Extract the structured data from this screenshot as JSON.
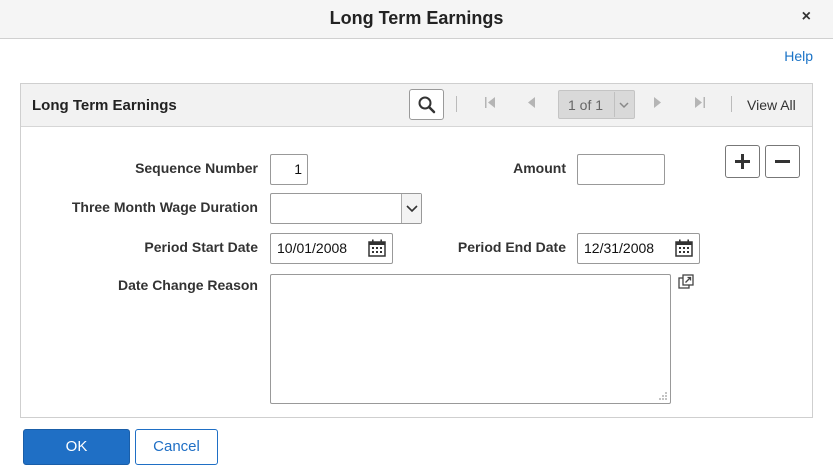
{
  "window": {
    "title": "Long Term Earnings",
    "close_glyph": "×",
    "help_link": "Help"
  },
  "panel": {
    "title": "Long Term Earnings",
    "pager_text": "1 of 1",
    "view_all": "View All"
  },
  "form": {
    "sequence_number_label": "Sequence Number",
    "sequence_number_value": "1",
    "amount_label": "Amount",
    "amount_value": "",
    "wage_duration_label": "Three Month Wage Duration",
    "wage_duration_value": "",
    "period_start_label": "Period Start Date",
    "period_start_value": "10/01/2008",
    "period_end_label": "Period End Date",
    "period_end_value": "12/31/2008",
    "date_change_reason_label": "Date Change Reason",
    "date_change_reason_value": ""
  },
  "footer": {
    "ok_label": "OK",
    "cancel_label": "Cancel"
  },
  "colors": {
    "accent": "#1f6fc5",
    "header_bg": "#f5f5f5"
  }
}
